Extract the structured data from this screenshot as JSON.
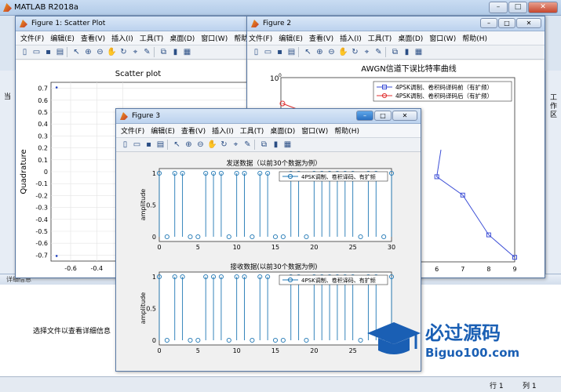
{
  "main": {
    "title": "MATLAB R2018a",
    "right_panel_label": "工作区",
    "left_strip_label": "当",
    "detail_header": "详细信息",
    "detail_message": "选择文件以查看详细信息",
    "status_row": "行 1",
    "status_col": "列 1"
  },
  "menus": [
    "文件(F)",
    "编辑(E)",
    "查看(V)",
    "插入(I)",
    "工具(T)",
    "桌面(D)",
    "窗口(W)",
    "帮助(H)"
  ],
  "window_buttons": {
    "minimize": "–",
    "maximize": "□",
    "close": "✕"
  },
  "figure1": {
    "title": "Figure 1: Scatter Plot",
    "plot_title": "Scatter plot",
    "ylabel": "Quadrature",
    "yticks": [
      "0.7",
      "0.6",
      "0.5",
      "0.4",
      "0.3",
      "0.2",
      "0.1",
      "0",
      "-0.1",
      "-0.2",
      "-0.3",
      "-0.4",
      "-0.5",
      "-0.6",
      "-0.7"
    ],
    "xticks": [
      "-0.6",
      "-0.4",
      "-0.2"
    ]
  },
  "figure2": {
    "title": "Figure 2",
    "plot_title": "AWGN信道下误比特率曲线",
    "y_top_tick": "10",
    "y_top_exp": "0",
    "xticks": [
      "6",
      "7",
      "8",
      "9"
    ],
    "legend": [
      "4PSK调制、卷积码译码前（有扩频）",
      "4PSK调制、卷积码译码后（有扩频）"
    ],
    "colors": {
      "series1": "#3d4fd6",
      "series2": "#e03030"
    }
  },
  "figure3": {
    "title": "Figure 3",
    "top_title": "发送数据（以前30个数据为例）",
    "bottom_title": "接收数据(以前30个数据为例)",
    "ylabel": "amplitude",
    "legend": "4PSK调制、卷积译码、有扩频",
    "yticks": [
      "1",
      "0.5",
      "0"
    ],
    "xticks": [
      "0",
      "5",
      "10",
      "15",
      "20",
      "25",
      "30"
    ],
    "stem_color": "#1f77b4"
  },
  "chart_data": [
    {
      "type": "scatter",
      "title": "Scatter plot",
      "xlabel": "",
      "ylabel": "Quadrature",
      "x": [
        -0.707,
        -0.707
      ],
      "y": [
        0.707,
        -0.707
      ],
      "xlim": [
        -0.75,
        0.75
      ],
      "ylim": [
        -0.75,
        0.75
      ]
    },
    {
      "type": "line",
      "title": "AWGN信道下误比特率曲线",
      "series": [
        {
          "name": "4PSK调制、卷积码译码前（有扩频）",
          "x": [
            6,
            7,
            8,
            9
          ],
          "y": [
            0.0055,
            0.0021,
            0.00026,
            8e-05
          ]
        }
      ],
      "xlim": [
        0,
        9
      ]
    },
    {
      "type": "bar",
      "title": "发送数据（以前30个数据为例）",
      "ylabel": "amplitude",
      "legend": "4PSK调制、卷积译码、有扩频",
      "x": [
        0,
        1,
        2,
        3,
        4,
        5,
        6,
        7,
        8,
        9,
        10,
        11,
        12,
        13,
        14,
        15,
        16,
        17,
        18,
        19,
        20,
        21,
        22,
        23,
        24,
        25,
        26,
        27,
        28,
        29,
        30
      ],
      "values": [
        1,
        0,
        1,
        1,
        0,
        0,
        1,
        1,
        1,
        0,
        1,
        1,
        0,
        1,
        1,
        0,
        0,
        1,
        1,
        0,
        1,
        1,
        1,
        1,
        1,
        1,
        0,
        1,
        1,
        0,
        1
      ],
      "xlim": [
        0,
        30
      ],
      "ylim": [
        0,
        1
      ]
    },
    {
      "type": "bar",
      "title": "接收数据(以前30个数据为例)",
      "ylabel": "amplitude",
      "legend": "4PSK调制、卷积译码、有扩频",
      "x": [
        0,
        1,
        2,
        3,
        4,
        5,
        6,
        7,
        8,
        9,
        10,
        11,
        12,
        13,
        14,
        15,
        16,
        17,
        18,
        19,
        20,
        21,
        22,
        23,
        24,
        25,
        26,
        27,
        28,
        29,
        30
      ],
      "values": [
        1,
        0,
        1,
        1,
        0,
        0,
        1,
        1,
        1,
        0,
        1,
        1,
        0,
        1,
        1,
        0,
        0,
        1,
        1,
        0,
        1,
        1,
        1,
        1,
        1,
        1,
        0,
        1,
        1,
        0,
        1
      ],
      "xlim": [
        0,
        30
      ],
      "ylim": [
        0,
        1
      ]
    }
  ],
  "logo": {
    "cn": "必过源码",
    "en": "Biguo100.com"
  }
}
